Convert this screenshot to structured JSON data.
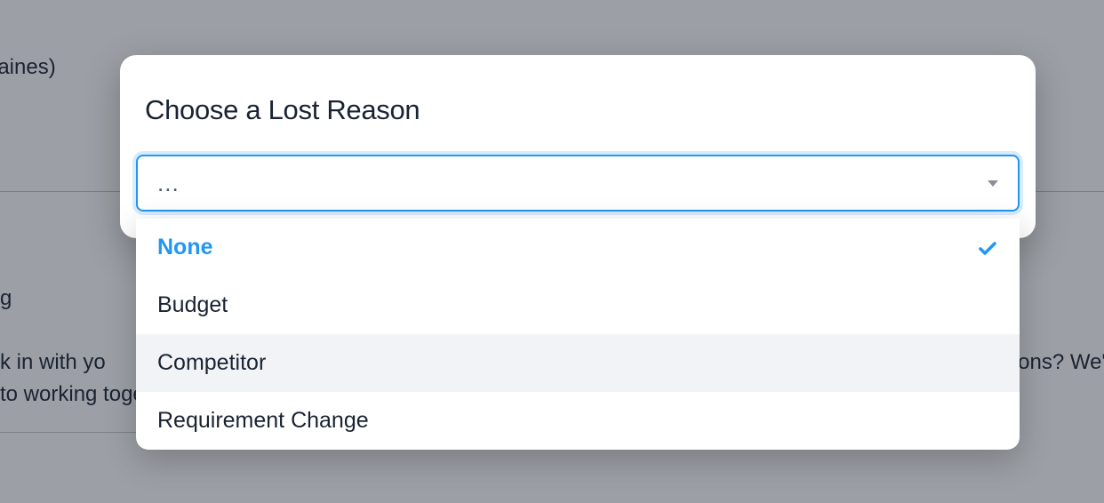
{
  "background": {
    "text1": "Haines)",
    "text2": "g",
    "text3": "k in with yo",
    "text4": "to working toge",
    "text5": "ions? We'r"
  },
  "modal": {
    "title": "Choose a Lost Reason",
    "select": {
      "placeholder": "..."
    },
    "options": [
      {
        "label": "None",
        "selected": true,
        "hovered": false
      },
      {
        "label": "Budget",
        "selected": false,
        "hovered": false
      },
      {
        "label": "Competitor",
        "selected": false,
        "hovered": true
      },
      {
        "label": "Requirement Change",
        "selected": false,
        "hovered": false
      }
    ]
  },
  "colors": {
    "accent": "#2196f3",
    "text": "#1a2332",
    "backdrop": "#9ca0a6"
  }
}
